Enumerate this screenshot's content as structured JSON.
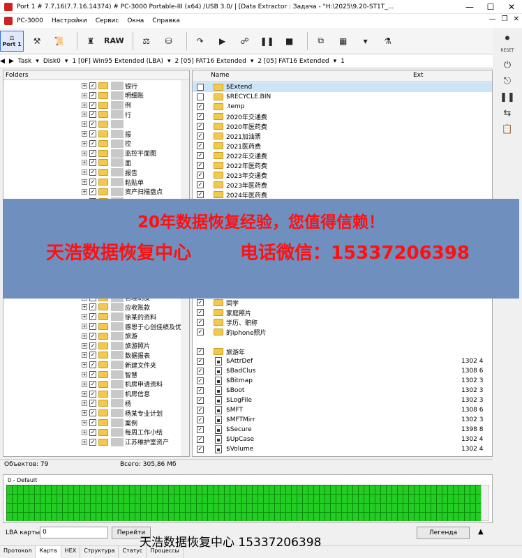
{
  "window": {
    "title": "Port 1 # 7.7.16(7.7.16.14374) # PC-3000 Portable-III (x64) /USB 3.0/                   | [Data Extractor : Задача - \"H:\\2025\\9.20-ST1T_..."
  },
  "menu": {
    "items": [
      "PC-3000",
      "Настройки",
      "Сервис",
      "Окна",
      "Справка"
    ]
  },
  "toolbar": {
    "port_label": "Port 1",
    "raw_label": "RAW"
  },
  "pathbar": {
    "task": "Task",
    "disk": "Disk0",
    "p1": "1 [0F] Win95 Extended  (LBA)",
    "p2": "2 [05] FAT16 Extended",
    "p3": "2 [05] FAT16 Extended",
    "p4": "1"
  },
  "left_pane": {
    "header": "Folders",
    "items": [
      "银行",
      "明细账",
      "例",
      "行",
      "",
      "报",
      "控",
      "监控平面图",
      "面",
      "报告",
      "粘贴单",
      "资产扫描盘点",
      "",
      "",
      "",
      "",
      "",
      "",
      "",
      "",
      "",
      "",
      "管理制度",
      "应收账款",
      "徐某的资料",
      "感恩于心创佳绩及优秀",
      "旅游",
      "旅游照片",
      "数据报表",
      "新建文件夹",
      "智慧",
      "机房申请资料",
      "机房信息",
      "杨",
      "杨某专业计划",
      "案例",
      "每周工作小结",
      "江苏维护室资产"
    ]
  },
  "right_pane": {
    "col_name": "Name",
    "col_ext": "Ext",
    "rows": [
      {
        "name": "$Extend",
        "size": ""
      },
      {
        "name": "$RECYCLE.BIN",
        "size": ""
      },
      {
        "name": ".temp",
        "size": ""
      },
      {
        "name": "2020年交通费",
        "size": ""
      },
      {
        "name": "2020年医药费",
        "size": ""
      },
      {
        "name": "2021加油票",
        "size": ""
      },
      {
        "name": "2021医药费",
        "size": ""
      },
      {
        "name": "2022年交通费",
        "size": ""
      },
      {
        "name": "2022年医药费",
        "size": ""
      },
      {
        "name": "2023年交通费",
        "size": ""
      },
      {
        "name": "2023年医药费",
        "size": ""
      },
      {
        "name": "2024年医药费",
        "size": ""
      },
      {
        "name": "同学",
        "size": ""
      },
      {
        "name": "家庭照片",
        "size": ""
      },
      {
        "name": "学历、职称",
        "size": ""
      },
      {
        "name": "的iphone照片",
        "size": ""
      },
      {
        "name": "旅游年",
        "size": ""
      },
      {
        "name": "$AttrDef",
        "size": "1302 4"
      },
      {
        "name": "$BadClus",
        "size": "1308 6"
      },
      {
        "name": "$Bitmap",
        "size": "1302 3"
      },
      {
        "name": "$Boot",
        "size": "1302 3"
      },
      {
        "name": "$LogFile",
        "size": "1302 3"
      },
      {
        "name": "$MFT",
        "size": "1308 6"
      },
      {
        "name": "$MFTMirr",
        "size": "1302 3"
      },
      {
        "name": "$Secure",
        "size": "1398 8"
      },
      {
        "name": "$UpCase",
        "size": "1302 4"
      },
      {
        "name": "$Volume",
        "size": "1302 4"
      }
    ]
  },
  "banner": {
    "line1": "20年数据恢复经验，您值得信赖！",
    "line2": "天浩数据恢复中心",
    "line3": "电话微信：15337206398"
  },
  "status": {
    "objects": "Объектов: 79",
    "total": "Всего: 305,86 Мб"
  },
  "map": {
    "label": "0 - Default",
    "cell_color": "#22cc22"
  },
  "bottom": {
    "lba_label": "LBA карты",
    "lba_value": "0",
    "go_label": "Перейти",
    "legend_label": "Легенда"
  },
  "watermark": "天浩数据恢复中心   15337206398",
  "tabs": [
    "Протокол",
    "Карта",
    "HEX",
    "Структура",
    "Статус",
    "Процессы"
  ]
}
